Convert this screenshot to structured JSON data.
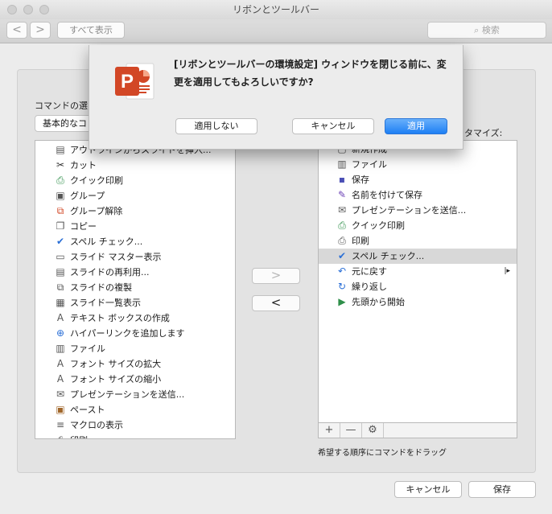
{
  "window": {
    "title": "リボンとツールバー"
  },
  "toolbar": {
    "back": "<",
    "forward": ">",
    "show_all": "すべて表示",
    "search_placeholder": "検索"
  },
  "left": {
    "heading": "コマンドの選",
    "popup_value": "基本的なコ",
    "items": [
      {
        "label": "アウトラインからスライドを挿入...",
        "icon": "outline-icon"
      },
      {
        "label": "カット",
        "icon": "scissors-icon"
      },
      {
        "label": "クイック印刷",
        "icon": "quick-print-icon"
      },
      {
        "label": "グループ",
        "icon": "group-icon"
      },
      {
        "label": "グループ解除",
        "icon": "ungroup-icon"
      },
      {
        "label": "コピー",
        "icon": "copy-icon"
      },
      {
        "label": "スペル チェック...",
        "icon": "spell-check-icon"
      },
      {
        "label": "スライド マスター表示",
        "icon": "slide-master-icon"
      },
      {
        "label": "スライドの再利用...",
        "icon": "reuse-slides-icon"
      },
      {
        "label": "スライドの複製",
        "icon": "duplicate-slide-icon"
      },
      {
        "label": "スライド一覧表示",
        "icon": "slide-sorter-icon"
      },
      {
        "label": "テキスト ボックスの作成",
        "icon": "text-box-icon"
      },
      {
        "label": "ハイパーリンクを追加します",
        "icon": "hyperlink-icon"
      },
      {
        "label": "ファイル",
        "icon": "file-icon"
      },
      {
        "label": "フォント サイズの拡大",
        "icon": "font-grow-icon"
      },
      {
        "label": "フォント サイズの縮小",
        "icon": "font-shrink-icon"
      },
      {
        "label": "プレゼンテーションを送信...",
        "icon": "send-icon"
      },
      {
        "label": "ペースト",
        "icon": "paste-icon"
      },
      {
        "label": "マクロの表示",
        "icon": "macro-icon"
      },
      {
        "label": "印刷",
        "icon": "print-icon"
      }
    ]
  },
  "right": {
    "heading": "スタマイズ:",
    "items": [
      {
        "label": "新規作成",
        "icon": "new-icon"
      },
      {
        "label": "ファイル",
        "icon": "file-icon"
      },
      {
        "label": "保存",
        "icon": "save-icon"
      },
      {
        "label": "名前を付けて保存",
        "icon": "save-as-icon"
      },
      {
        "label": "プレゼンテーションを送信...",
        "icon": "send-icon"
      },
      {
        "label": "クイック印刷",
        "icon": "quick-print-icon"
      },
      {
        "label": "印刷",
        "icon": "print-icon"
      },
      {
        "label": "スペル チェック...",
        "icon": "spell-check-icon"
      },
      {
        "label": "元に戻す",
        "icon": "undo-icon"
      },
      {
        "label": "繰り返し",
        "icon": "redo-icon"
      },
      {
        "label": "先頭から開始",
        "icon": "slideshow-icon"
      }
    ],
    "selected_index": 7,
    "add_btn": "+",
    "remove_btn": "—",
    "hint": "希望する順序にコマンドをドラッグ"
  },
  "arrows": {
    "add": ">",
    "remove": "<"
  },
  "footer": {
    "cancel": "キャンセル",
    "save": "保存"
  },
  "dialog": {
    "message_line1": "[リボンとツールバーの環境設定] ウィンドウを閉じる前に、変",
    "message_line2": "更を適用してもよろしいですか?",
    "dont_apply": "適用しない",
    "cancel": "キャンセル",
    "apply": "適用",
    "app_icon": "powerpoint-icon"
  },
  "colors": {
    "accent": "#1e7ff4",
    "brand_ppt": "#d24726"
  }
}
